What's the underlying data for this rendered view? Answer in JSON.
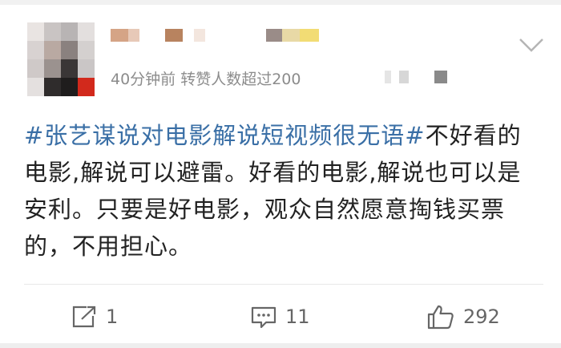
{
  "post": {
    "meta": "40分钟前  转赞人数超过200",
    "topic": "#张艺谋说对电影解说短视频很无语#",
    "text": "不好看的电影,解说可以避雷。好看的电影,解说也可以是安利。只要是好电影，观众自然愿意掏钱买票的，不用担心。"
  },
  "actions": {
    "repost_count": "1",
    "comment_count": "11",
    "like_count": "292"
  },
  "icons": {
    "more": "chevron-down-icon",
    "repost": "share-icon",
    "comment": "comment-icon",
    "like": "thumbs-up-icon"
  },
  "colors": {
    "topic": "#3a6fa6",
    "meta": "#8c8c8c",
    "text": "#222222"
  }
}
